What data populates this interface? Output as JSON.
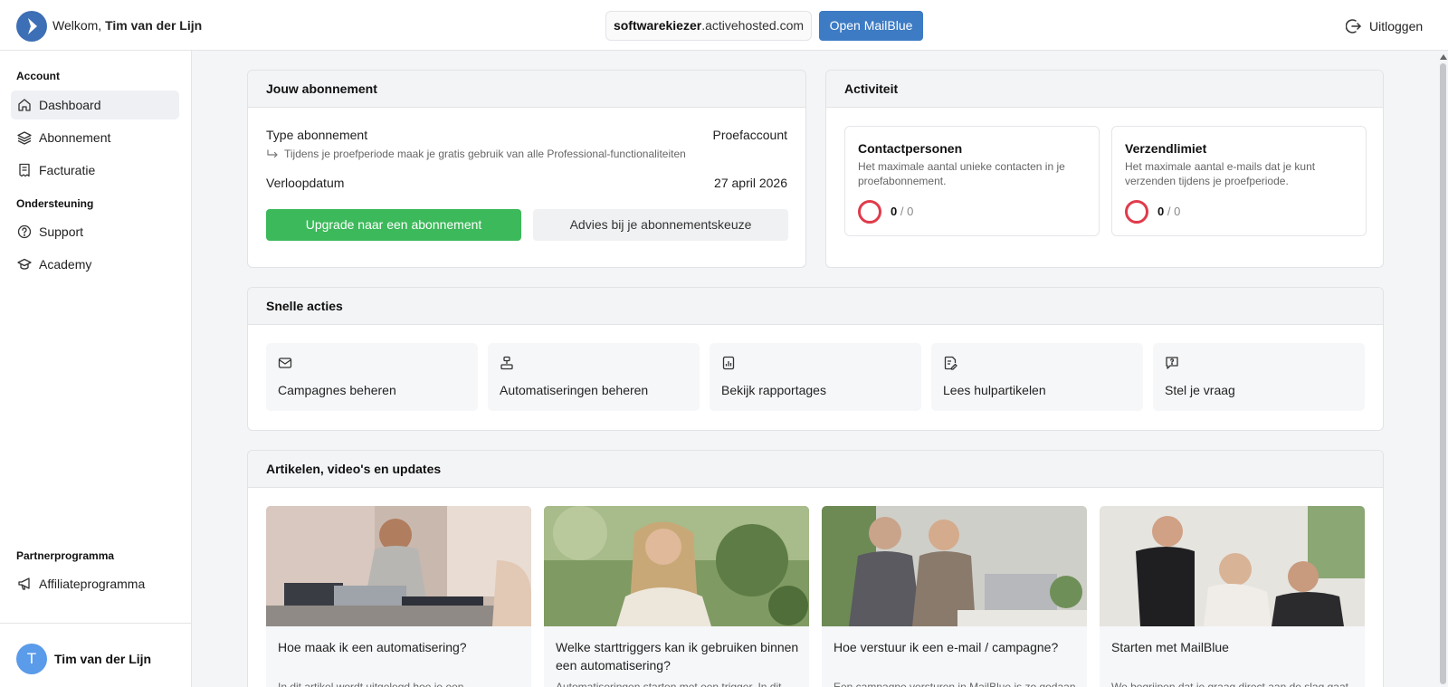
{
  "header": {
    "welcome_prefix": "Welkom,",
    "user_name": "Tim van der Lijn",
    "domain_bold": "softwarekiezer",
    "domain_rest": ".activehosted.com",
    "open_button": "Open MailBlue",
    "logout": "Uitloggen"
  },
  "sidebar": {
    "section_account": "Account",
    "items_account": [
      {
        "label": "Dashboard",
        "icon": "home-icon",
        "active": true
      },
      {
        "label": "Abonnement",
        "icon": "layers-icon"
      },
      {
        "label": "Facturatie",
        "icon": "receipt-icon"
      }
    ],
    "section_support": "Ondersteuning",
    "items_support": [
      {
        "label": "Support",
        "icon": "help-circle-icon"
      },
      {
        "label": "Academy",
        "icon": "graduation-cap-icon"
      }
    ],
    "section_partner": "Partnerprogramma",
    "items_partner": [
      {
        "label": "Affiliateprogramma",
        "icon": "megaphone-icon"
      }
    ],
    "footer_initial": "T",
    "footer_name": "Tim van der Lijn"
  },
  "subscription": {
    "title": "Jouw abonnement",
    "type_label": "Type abonnement",
    "type_value": "Proefaccount",
    "note": "Tijdens je proefperiode maak je gratis gebruik van alle Professional-functionaliteiten",
    "expiry_label": "Verloopdatum",
    "expiry_value": "27 april 2026",
    "upgrade_button": "Upgrade naar een abonnement",
    "advice_button": "Advies bij je abonnementskeuze"
  },
  "activity": {
    "title": "Activiteit",
    "boxes": [
      {
        "title": "Contactpersonen",
        "desc": "Het maximale aantal unieke contacten in je proefabonnement.",
        "used": "0",
        "sep": " / ",
        "limit": "0"
      },
      {
        "title": "Verzendlimiet",
        "desc": "Het maximale aantal e-mails dat je kunt verzenden tijdens je proefperiode.",
        "used": "0",
        "sep": " / ",
        "limit": "0"
      }
    ]
  },
  "quick_actions": {
    "title": "Snelle acties",
    "items": [
      {
        "label": "Campagnes beheren",
        "icon": "mail-icon"
      },
      {
        "label": "Automatiseringen beheren",
        "icon": "workflow-icon"
      },
      {
        "label": "Bekijk rapportages",
        "icon": "chart-file-icon"
      },
      {
        "label": "Lees hulpartikelen",
        "icon": "document-edit-icon"
      },
      {
        "label": "Stel je vraag",
        "icon": "question-message-icon"
      }
    ]
  },
  "articles": {
    "title": "Artikelen, video's en updates",
    "items": [
      {
        "title": "Hoe maak ik een automatisering?",
        "excerpt": "In dit artikel wordt uitgelegd hoe je een"
      },
      {
        "title": "Welke starttriggers kan ik gebruiken binnen een automatisering?",
        "excerpt": "Automatiseringen starten met een trigger. In dit"
      },
      {
        "title": "Hoe verstuur ik een e-mail / campagne?",
        "excerpt": "Een campagne versturen in MailBlue is zo gedaan"
      },
      {
        "title": "Starten met MailBlue",
        "excerpt": "We begrijpen dat je graag direct aan de slag gaat"
      }
    ]
  },
  "colors": {
    "brand_blue": "#3d7bc4",
    "upgrade_green": "#3cb95a",
    "ring_red": "#e03b4b"
  }
}
